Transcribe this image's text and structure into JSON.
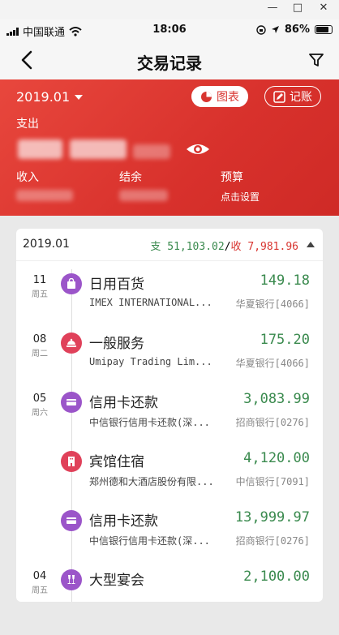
{
  "window_controls": {
    "minimize": "—",
    "maximize": "□",
    "close": "✕"
  },
  "status_bar": {
    "carrier": "中国联通",
    "time": "18:06",
    "battery": "86%"
  },
  "nav": {
    "title": "交易记录",
    "back_icon": "chevron-left-icon",
    "filter_icon": "filter-icon"
  },
  "header": {
    "month": "2019.01",
    "chart_button": "图表",
    "bookkeep_button": "记账",
    "expense_label": "支出",
    "income_label": "收入",
    "balance_label": "结余",
    "budget_label": "预算",
    "budget_action": "点击设置",
    "background_color": "#dc3a33"
  },
  "list": {
    "month": "2019.01",
    "expense_prefix": "支",
    "expense_total": "51,103.02",
    "separator": "/",
    "income_prefix": "收",
    "income_total": "7,981.96",
    "items": [
      {
        "day": "11",
        "weekday": "周五",
        "category": "日用百货",
        "amount": "149.18",
        "description": "IMEX INTERNATIONAL...",
        "bank": "华夏银行[4066]",
        "icon": "shopping-bag-icon",
        "icon_color": "#9b55c9"
      },
      {
        "day": "08",
        "weekday": "周二",
        "category": "一般服务",
        "amount": "175.20",
        "description": "Umipay Trading Lim...",
        "bank": "华夏银行[4066]",
        "icon": "service-icon",
        "icon_color": "#e0415a"
      },
      {
        "day": "05",
        "weekday": "周六",
        "category": "信用卡还款",
        "amount": "3,083.99",
        "description": "中信银行信用卡还款(深...",
        "bank": "招商银行[0276]",
        "icon": "credit-card-icon",
        "icon_color": "#9b55c9"
      },
      {
        "day": "",
        "weekday": "",
        "category": "宾馆住宿",
        "amount": "4,120.00",
        "description": "郑州德和大酒店股份有限...",
        "bank": "中信银行[7091]",
        "icon": "hotel-icon",
        "icon_color": "#e0415a"
      },
      {
        "day": "",
        "weekday": "",
        "category": "信用卡还款",
        "amount": "13,999.97",
        "description": "中信银行信用卡还款(深...",
        "bank": "招商银行[0276]",
        "icon": "credit-card-icon",
        "icon_color": "#9b55c9"
      },
      {
        "day": "04",
        "weekday": "周五",
        "category": "大型宴会",
        "amount": "2,100.00",
        "description": "",
        "bank": "",
        "icon": "banquet-icon",
        "icon_color": "#9b55c9"
      }
    ]
  }
}
